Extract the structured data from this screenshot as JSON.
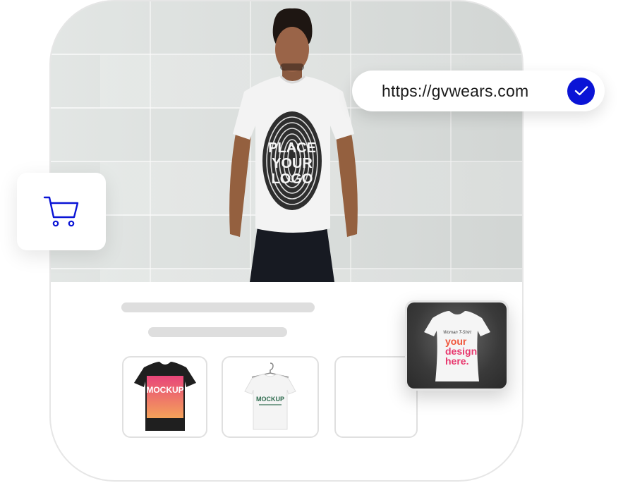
{
  "url_bar": {
    "url": "https://gvwears.com",
    "verified_icon": "check-circle-icon",
    "accent_color": "#0a14d6"
  },
  "cart": {
    "icon": "shopping-cart-icon",
    "icon_color": "#0a14d6"
  },
  "hero": {
    "shirt_print_line1": "PLACE",
    "shirt_print_line2": "YOUR",
    "shirt_print_line3": "LOGO"
  },
  "thumbnails": [
    {
      "name": "black-tshirt-mockup",
      "print_text": "MOCKUP",
      "shirt_color": "#1f1f1f"
    },
    {
      "name": "white-tshirt-hanger-mockup",
      "print_text": "MOCKUP",
      "shirt_color": "#f4f4f4"
    },
    {
      "name": "empty-slot"
    }
  ],
  "featured_thumb": {
    "script_text": "Woman T-Shirt",
    "line1": "your",
    "line2": "design",
    "line3": "here."
  }
}
